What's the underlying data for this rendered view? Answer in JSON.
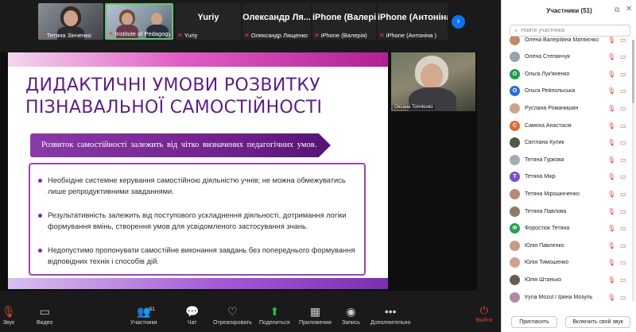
{
  "video_strip": {
    "tiles": [
      {
        "name": "Тетяна Зінченко",
        "type": "video"
      },
      {
        "name": "Institute of Pedagogy ...",
        "type": "video"
      },
      {
        "name": "Yuriy",
        "type": "name"
      },
      {
        "name": "Олександр Ля...",
        "caption": "Олександр Лященко",
        "type": "name"
      },
      {
        "name": "iPhone (Валерія)",
        "caption": "iPhone (Валерія)",
        "type": "name"
      },
      {
        "name": "iPhone (Антоніна)",
        "caption": "iPhone (Антоніна )",
        "type": "name"
      }
    ],
    "third_caption": "Yuriy"
  },
  "slide": {
    "title_line1": "Дидактичні умови розвитку",
    "title_line2": "пізнавальної самостійності",
    "subtitle": "Розвиток самостійності залежить від чітко визначених педагогічних умов.",
    "bullets": [
      "Необхідне системне керування самостійною діяльністю учнів; не можна обмежуватись лише репродуктивними завданнями.",
      "Результативність залежить від поступового ускладнення діяльності, дотримання логіки формування вмінь, створення умов для усвідомленого застосування знань.",
      "Недопустимо пропонувати самостійне виконання завдань без попереднього формування відповідних технік і способів дій."
    ]
  },
  "speaker": {
    "caption": "Оксана Топчієнко"
  },
  "toolbar": {
    "audio": "Звук",
    "video": "Видео",
    "participants": "Участники",
    "participants_count": "51",
    "chat": "Чат",
    "react": "Отреагировать",
    "share": "Поделиться",
    "apps": "Приложения",
    "record": "Запись",
    "more": "Дополнительно",
    "leave": "Выйти"
  },
  "panel": {
    "title": "Участники (51)",
    "search_placeholder": "Найти участника",
    "invite": "Пригласить",
    "unmute_me": "Включить свой звук",
    "participants": [
      {
        "name": "Олена Валеріївна Матвієнко",
        "avatar_color": "#c08a6a",
        "initial": ""
      },
      {
        "name": "Олена Степанчук",
        "avatar_color": "#9aa3ad",
        "initial": ""
      },
      {
        "name": "Ольга Лук'яненко",
        "avatar_color": "#1f9e4b",
        "initial": "О"
      },
      {
        "name": "Ольга Рейпольська",
        "avatar_color": "#2a6fd6",
        "initial": "О"
      },
      {
        "name": "Руслана Романишин",
        "avatar_color": "#c9a58d",
        "initial": ""
      },
      {
        "name": "Самоха Анастасія",
        "avatar_color": "#e06a2c",
        "initial": "С"
      },
      {
        "name": "Світлана Кулик",
        "avatar_color": "#4f5a46",
        "initial": ""
      },
      {
        "name": "Тетяна Гуркова",
        "avatar_color": "#a9a9b1",
        "initial": ""
      },
      {
        "name": "Тетяна Мікр",
        "avatar_color": "#7d4ed8",
        "initial": "Т"
      },
      {
        "name": "Тетяна Мірошніченко",
        "avatar_color": "#b58b73",
        "initial": ""
      },
      {
        "name": "Тетяна Павлова",
        "avatar_color": "#8e7a66",
        "initial": ""
      },
      {
        "name": "Форостюк Тетяна",
        "avatar_color": "#27a04f",
        "initial": "Ф"
      },
      {
        "name": "Юлія Павленко",
        "avatar_color": "#c79b86",
        "initial": ""
      },
      {
        "name": "Юлія Тимошенко",
        "avatar_color": "#d0a28c",
        "initial": ""
      },
      {
        "name": "Юлія Штанько",
        "avatar_color": "#6a5c52",
        "initial": ""
      },
      {
        "name": "Iryna Mozul / Ірина Мозуль",
        "avatar_color": "#b08aa4",
        "initial": ""
      }
    ]
  }
}
